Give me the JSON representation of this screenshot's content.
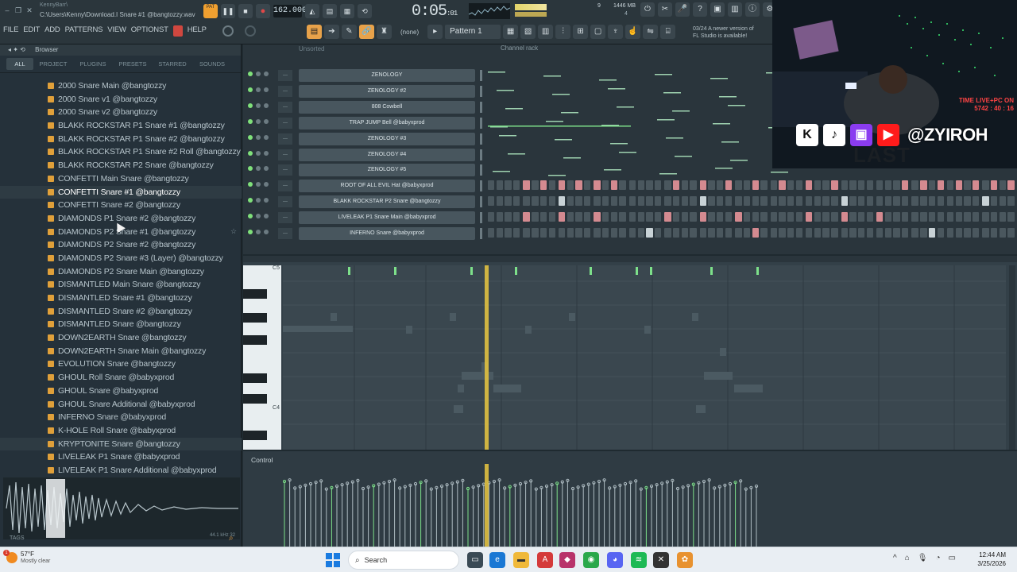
{
  "window": {
    "user": "KennyBarr\\",
    "file_path": "C:\\Users\\Kenny\\Download.I Snare #1 @bangtozzy.wav"
  },
  "menu": [
    "FILE",
    "EDIT",
    "ADD",
    "PATTERNS",
    "VIEW",
    "OPTIONS",
    "T",
    "HELP"
  ],
  "transport": {
    "pat_label": "PAT",
    "tempo": "162.000",
    "time_main": "0:05",
    "time_sub": ":01",
    "cpu": "9",
    "memory": "1446 MB",
    "mem_sub": "4"
  },
  "toolbar": {
    "pattern_none": "(none)",
    "pattern": "Pattern 1",
    "news_line1": "03/24 A newer version of",
    "news_line2": "FL Studio is available!"
  },
  "browser": {
    "title": "Browser",
    "tabs": [
      "ALL",
      "PROJECT",
      "PLUGINS",
      "PRESETS",
      "STARRED",
      "SOUNDS"
    ],
    "files": [
      "2000 Snare Main @bangtozzy",
      "2000 Snare v1 @bangtozzy",
      "2000 Snare v2 @bangtozzy",
      "BLAKK ROCKSTAR P1 Snare #1 @bangtozzy",
      "BLAKK ROCKSTAR P1 Snare #2 @bangtozzy",
      "BLAKK ROCKSTAR P1 Snare #2 Roll @bangtozzy",
      "BLAKK ROCKSTAR P2 Snare @bangtozzy",
      "CONFETTI Main Snare @bangtozzy",
      "CONFETTI Snare #1 @bangtozzy",
      "CONFETTI Snare #2 @bangtozzy",
      "DIAMONDS P1 Snare #2 @bangtozzy",
      "DIAMONDS P2 Snare #1 @bangtozzy",
      "DIAMONDS P2 Snare #2 @bangtozzy",
      "DIAMONDS P2 Snare #3 (Layer) @bangtozzy",
      "DIAMONDS P2 Snare Main @bangtozzy",
      "DISMANTLED Main Snare @bangtozzy",
      "DISMANTLED Snare #1 @bangtozzy",
      "DISMANTLED Snare #2 @bangtozzy",
      "DISMANTLED Snare @bangtozzy",
      "DOWN2EARTH Snare @bangtozzy",
      "DOWN2EARTH Snare Main @bangtozzy",
      "EVOLUTION Snare @bangtozzy",
      "GHOUL Roll Snare @babyxprod",
      "GHOUL Snare @babyxprod",
      "GHOUL Snare Additional @babyxprod",
      "INFERNO Snare @babyxprod",
      "K-HOLE Roll Snare @babyxprod",
      "KRYPTONITE Snare @bangtozzy",
      "LIVELEAK P1 Snare @babyxprod",
      "LIVELEAK P1 Snare Additional @babyxprod"
    ],
    "wave_info": "44.1 kHz 32",
    "tags_label": "TAGS"
  },
  "channel_rack": {
    "filter": "Unsorted",
    "title": "Channel rack",
    "channels": [
      "ZENOLOGY",
      "ZENOLOGY #2",
      "808 Cowbell",
      "TRAP JUMP Bell @babyxprod",
      "ZENOLOGY #3",
      "ZENOLOGY #4",
      "ZENOLOGY #5",
      "ROOT OF ALL EVIL Hat @babyxprod",
      "BLAKK ROCKSTAR P2 Snare @bangtozzy",
      "LIVELEAK P1 Snare Main @babyxprod",
      "INFERNO Snare @babyxprod"
    ]
  },
  "piano_roll": {
    "key_c5": "C5",
    "key_c4": "C4",
    "control_label": "Control"
  },
  "stream": {
    "live_line1": "TIME LIVE+PC ON",
    "live_line2": "5742 : 40 : 16",
    "handle": "@ZYIROH",
    "overlay_text": "LAST"
  },
  "taskbar": {
    "temp": "57°F",
    "weather": "Mostly clear",
    "badge": "1",
    "search": "Search",
    "time": "12:44 AM",
    "date": "3/25/2026"
  }
}
